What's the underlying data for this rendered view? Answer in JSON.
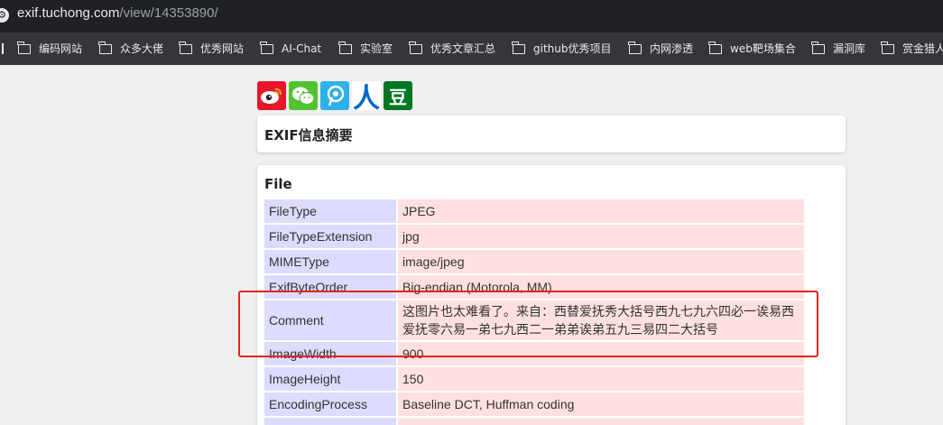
{
  "address_bar": {
    "domain": "exif.tuchong.com",
    "path": "/view/14353890/"
  },
  "bookmarks": [
    {
      "label": "编码网站"
    },
    {
      "label": "众多大佬"
    },
    {
      "label": "优秀网站"
    },
    {
      "label": "AI-Chat"
    },
    {
      "label": "实验室"
    },
    {
      "label": "优秀文章汇总"
    },
    {
      "label": "github优秀项目"
    },
    {
      "label": "内网渗透"
    },
    {
      "label": "web靶场集合"
    },
    {
      "label": "漏洞库"
    },
    {
      "label": "赏金猎人"
    }
  ],
  "share_icons": {
    "weibo": "weibo-icon",
    "wechat": "wechat-icon",
    "tencent": "tencent-weibo-icon",
    "renren": "人",
    "douban": "豆"
  },
  "summary": {
    "title": "EXIF信息摘要"
  },
  "file_section": {
    "title": "File",
    "rows": [
      {
        "key": "FileType",
        "value": "JPEG"
      },
      {
        "key": "FileTypeExtension",
        "value": "jpg"
      },
      {
        "key": "MIMEType",
        "value": "image/jpeg"
      },
      {
        "key": "ExifByteOrder",
        "value": "Big-endian (Motorola, MM)"
      },
      {
        "key": "Comment",
        "value": "这图片也太难看了。来自：西替爱抚秀大括号西九七九六四必一诶易西爱抚零六易一弟七九西二一弟弟诶弟五九三易四二大括号"
      },
      {
        "key": "ImageWidth",
        "value": "900"
      },
      {
        "key": "ImageHeight",
        "value": "150"
      },
      {
        "key": "EncodingProcess",
        "value": "Baseline DCT, Huffman coding"
      }
    ]
  },
  "colors": {
    "key_cell": "#dcdcff",
    "value_cell": "#ffe0e0",
    "highlight_box": "#e8231e"
  }
}
